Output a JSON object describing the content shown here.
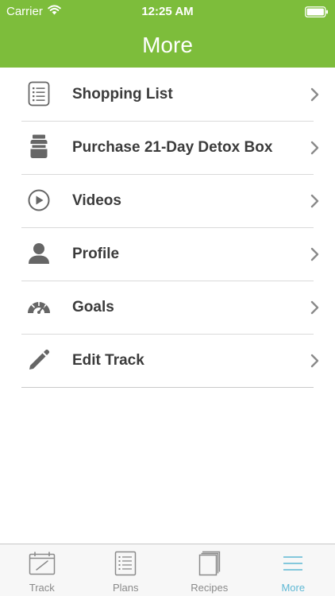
{
  "colors": {
    "header_bg": "#7dbd3b",
    "text_primary": "#3b3b3b",
    "icon_gray": "#666666",
    "tab_inactive": "#8a8a8a",
    "tab_active": "#5fb8d4",
    "divider": "#dadada"
  },
  "status_bar": {
    "carrier": "Carrier",
    "time": "12:25 AM",
    "wifi_icon": "wifi-icon",
    "battery_icon": "battery-icon"
  },
  "nav": {
    "title": "More"
  },
  "menu": {
    "items": [
      {
        "label": "Shopping List",
        "icon": "list-icon"
      },
      {
        "label": "Purchase 21-Day Detox Box",
        "icon": "jar-icon"
      },
      {
        "label": "Videos",
        "icon": "play-icon"
      },
      {
        "label": "Profile",
        "icon": "person-icon"
      },
      {
        "label": "Goals",
        "icon": "gauge-icon"
      },
      {
        "label": "Edit Track",
        "icon": "pencil-icon"
      }
    ]
  },
  "tabs": [
    {
      "label": "Track",
      "icon": "calendar-icon",
      "active": false
    },
    {
      "label": "Plans",
      "icon": "document-list-icon",
      "active": false
    },
    {
      "label": "Recipes",
      "icon": "book-icon",
      "active": false
    },
    {
      "label": "More",
      "icon": "hamburger-menu-icon",
      "active": true
    }
  ]
}
